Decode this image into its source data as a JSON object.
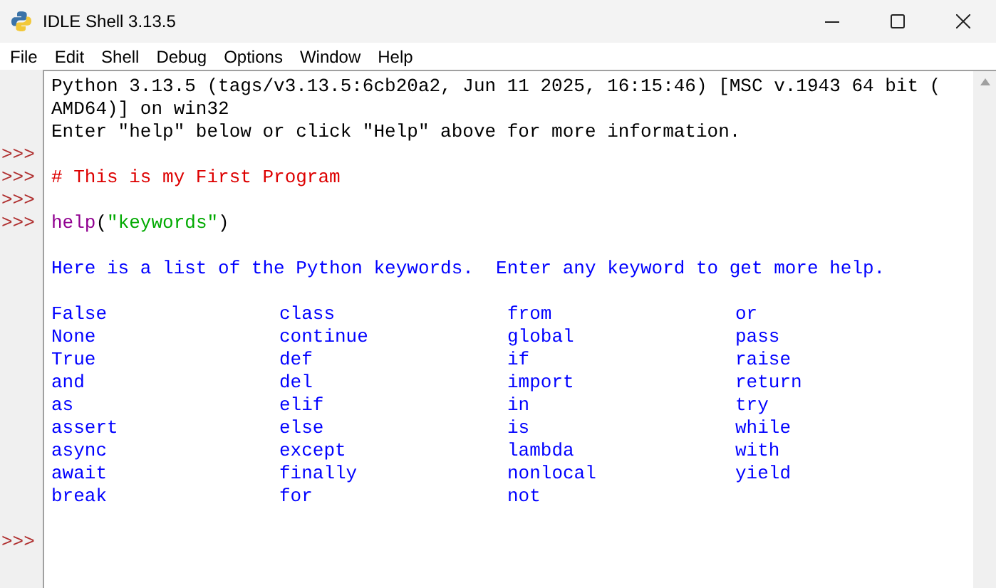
{
  "window": {
    "title": "IDLE Shell 3.13.5"
  },
  "menu": [
    "File",
    "Edit",
    "Shell",
    "Debug",
    "Options",
    "Window",
    "Help"
  ],
  "lines": [
    {
      "kind": "text",
      "segments": [
        {
          "kind": "plain",
          "text": "Python 3.13.5 (tags/v3.13.5:6cb20a2, Jun 11 2025, 16:15:46) [MSC v.1943 64 bit ("
        }
      ]
    },
    {
      "kind": "text",
      "segments": [
        {
          "kind": "plain",
          "text": "AMD64)] on win32"
        }
      ]
    },
    {
      "kind": "text",
      "segments": [
        {
          "kind": "plain",
          "text": "Enter \"help\" below or click \"Help\" above for more information."
        }
      ]
    },
    {
      "kind": "blank",
      "prompt": ">>>"
    },
    {
      "kind": "text",
      "prompt": ">>>",
      "segments": [
        {
          "kind": "comment",
          "text": "# This is my First Program"
        }
      ]
    },
    {
      "kind": "blank",
      "prompt": ">>>"
    },
    {
      "kind": "text",
      "prompt": ">>>",
      "segments": [
        {
          "kind": "builtin",
          "text": "help"
        },
        {
          "kind": "plain",
          "text": "("
        },
        {
          "kind": "string",
          "text": "\"keywords\""
        },
        {
          "kind": "plain",
          "text": ")"
        }
      ]
    },
    {
      "kind": "blank"
    },
    {
      "kind": "text",
      "segments": [
        {
          "kind": "stdout",
          "text": "Here is a list of the Python keywords.  Enter any keyword to get more help."
        }
      ]
    },
    {
      "kind": "blank"
    },
    {
      "kind": "keywords",
      "rows": [
        [
          "False",
          "class",
          "from",
          "or"
        ],
        [
          "None",
          "continue",
          "global",
          "pass"
        ],
        [
          "True",
          "def",
          "if",
          "raise"
        ],
        [
          "and",
          "del",
          "import",
          "return"
        ],
        [
          "as",
          "elif",
          "in",
          "try"
        ],
        [
          "assert",
          "else",
          "is",
          "while"
        ],
        [
          "async",
          "except",
          "lambda",
          "with"
        ],
        [
          "await",
          "finally",
          "nonlocal",
          "yield"
        ],
        [
          "break",
          "for",
          "not"
        ]
      ]
    },
    {
      "kind": "blank"
    },
    {
      "kind": "blank",
      "prompt": ">>>"
    }
  ]
}
